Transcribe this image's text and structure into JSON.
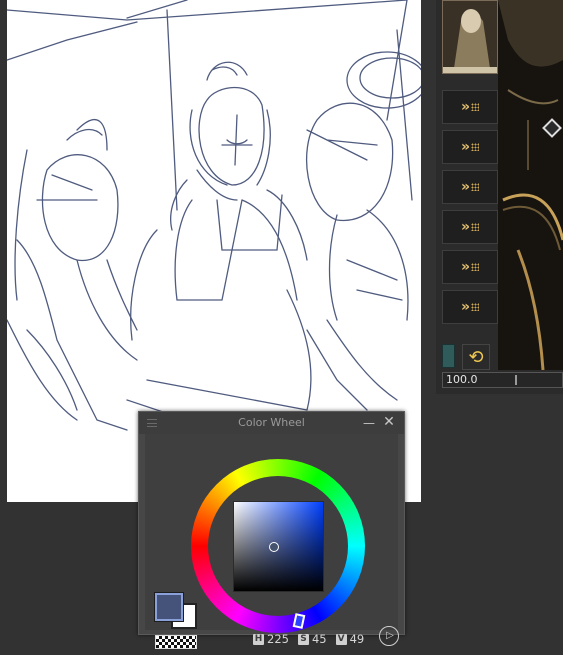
{
  "canvas": {
    "description_icon": "sketch-canvas"
  },
  "right_panel": {
    "opacity_value": "100.0",
    "layer_buttons": [
      "",
      "",
      "",
      "",
      "",
      ""
    ],
    "refresh_icon": "refresh-icon",
    "diamond_icon": "diamond-icon"
  },
  "color_wheel": {
    "title": "Color Wheel",
    "minimize_symbol": "—",
    "close_symbol": "✕",
    "h_tag": "H",
    "s_tag": "S",
    "v_tag": "V",
    "h_value": "225",
    "s_value": "45",
    "v_value": "49",
    "main_color": "#45527a",
    "sub_color": "#ffffff",
    "play_symbol": "▷"
  }
}
